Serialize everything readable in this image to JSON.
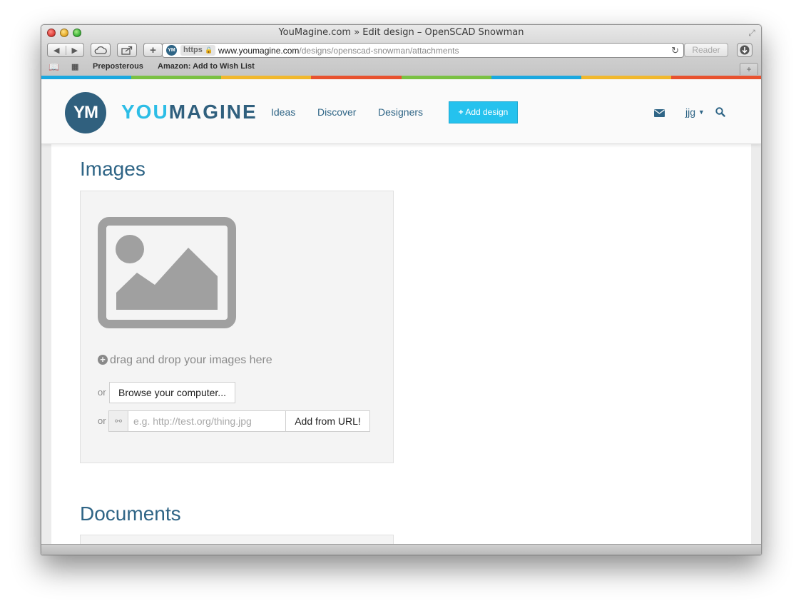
{
  "window": {
    "title": "YouMagine.com » Edit design – OpenSCAD Snowman"
  },
  "toolbar": {
    "url_scheme": "https",
    "url_domain": "www.youmagine.com",
    "url_path": "/designs/openscad-snowman/attachments",
    "reader_label": "Reader",
    "favicon_text": "YM"
  },
  "bookmarks": {
    "items": [
      {
        "label": "Preposterous"
      },
      {
        "label": "Amazon: Add to Wish List"
      }
    ]
  },
  "colors": {
    "stripe": [
      "#1aa8e0",
      "#7ac143",
      "#f1b82d",
      "#e8522f",
      "#7ac143",
      "#1aa8e0",
      "#f1b82d",
      "#e8522f"
    ],
    "brand_dark": "#30607e",
    "brand_light": "#2cbde6",
    "cta": "#25c2ee"
  },
  "site": {
    "logo_mark": "YM",
    "logo_you": "YOU",
    "logo_magine": "MAGINE",
    "nav": {
      "ideas": "Ideas",
      "discover": "Discover",
      "designers": "Designers"
    },
    "add_design": "Add design",
    "user": "jjg",
    "icons": {
      "mail": "envelope-icon",
      "search": "search-icon",
      "caret": "caret-down-icon"
    }
  },
  "images": {
    "title": "Images",
    "drag_text": "drag and drop your images here",
    "or": "or",
    "browse_label": "Browse your computer...",
    "url_placeholder": "e.g. http://test.org/thing.jpg",
    "add_url_label": "Add from URL!"
  },
  "documents": {
    "title": "Documents"
  }
}
